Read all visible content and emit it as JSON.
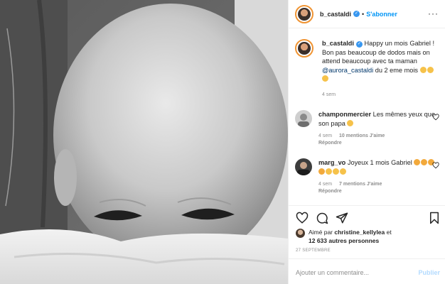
{
  "post": {
    "username": "b_castaldi",
    "separator": "•",
    "follow_label": "S'abonner",
    "more_label": "···"
  },
  "caption": {
    "username": "b_castaldi",
    "text_1": "Happy un mois Gabriel ! Bon pas beaucoup de dodos mais on attend beaucoup avec ta maman",
    "mention": "@aurora_castaldi",
    "text_2": "du 2 eme mois",
    "time": "4 sem"
  },
  "comments": [
    {
      "username": "champonmercier",
      "text": "Les mêmes yeux que son papa",
      "time": "4 sem",
      "likes": "10 mentions J'aime",
      "reply": "Répondre"
    },
    {
      "username": "marg_vo",
      "text": "Joyeux 1 mois Gabriel",
      "time": "4 sem",
      "likes": "7 mentions J'aime",
      "reply": "Répondre"
    }
  ],
  "likes": {
    "prefix": "Aimé par",
    "user": "christine_kellylea",
    "mid": "et",
    "others": "12 633 autres personnes"
  },
  "date": "27 SEPTEMBRE",
  "comment_box": {
    "placeholder": "Ajouter un commentaire...",
    "post_label": "Publier"
  },
  "icons": [
    "verified-icon",
    "heart-icon",
    "comment-icon",
    "share-icon",
    "bookmark-icon",
    "more-icon"
  ],
  "colors": {
    "accent": "#0095f6",
    "secondary": "#8e8e8e",
    "post_disabled": "#b3dbff"
  }
}
